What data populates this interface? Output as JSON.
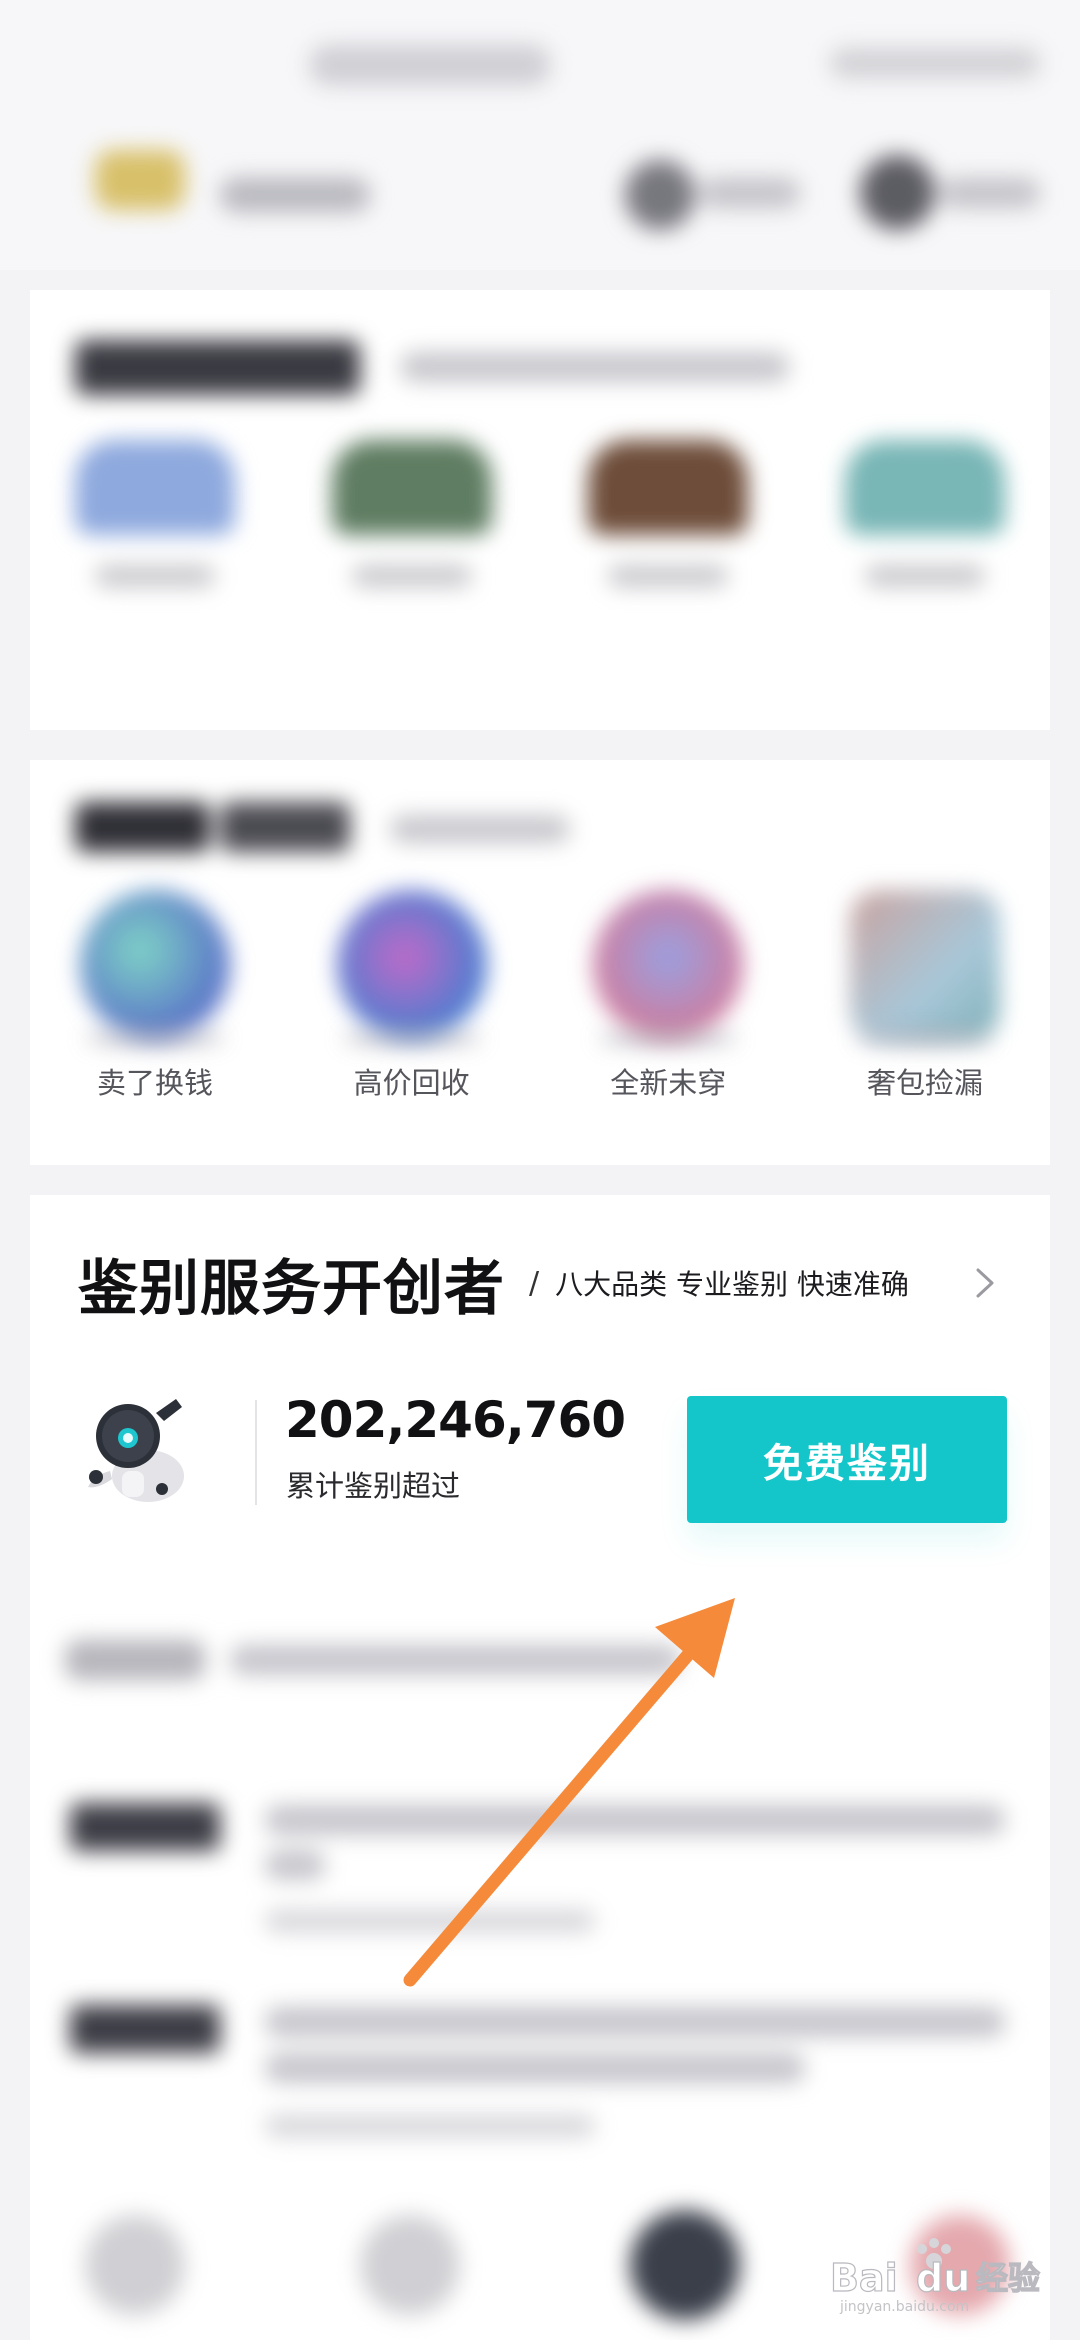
{
  "services": {
    "items": [
      {
        "label": "卖了换钱"
      },
      {
        "label": "高价回收"
      },
      {
        "label": "全新未穿"
      },
      {
        "label": "奢包捡漏"
      }
    ]
  },
  "identify": {
    "title": "鉴别服务开创者",
    "separator": "/",
    "subtitle": "八大品类 专业鉴别 快速准确",
    "count": "202,246,760",
    "count_label": "累计鉴别超过",
    "button_label": "免费鉴别"
  },
  "watermark": {
    "brand": "Bai",
    "brand2": "du",
    "cn": "经验",
    "url": "jingyan.baidu.com"
  },
  "colors": {
    "accent": "#14c6c9",
    "annotation_arrow": "#f58a3a"
  }
}
